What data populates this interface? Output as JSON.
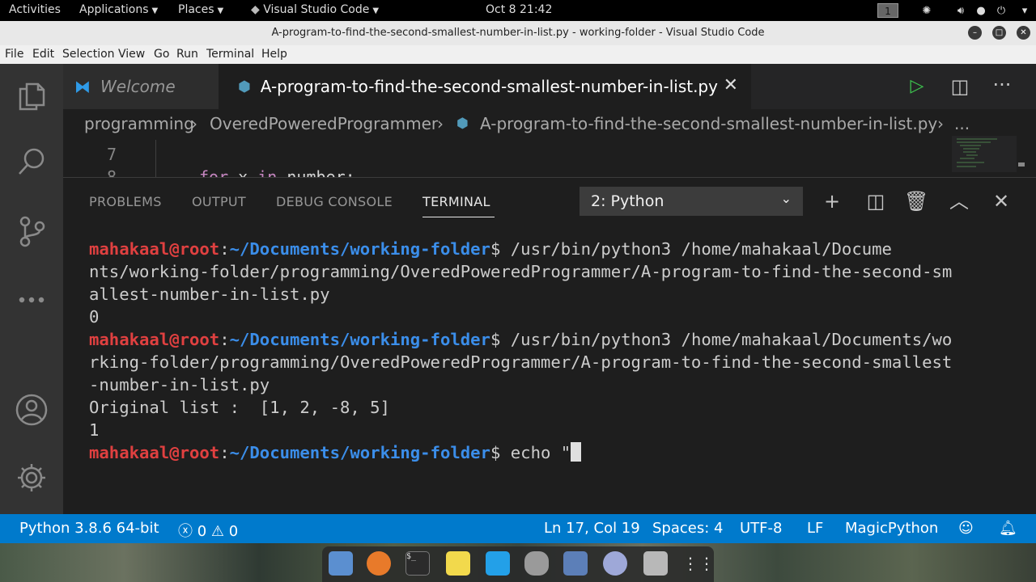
{
  "topbar": {
    "activities": "Activities",
    "applications": "Applications",
    "places": "Places",
    "app_name": "Visual Studio Code",
    "datetime": "Oct 8  21:42",
    "workspace": "1"
  },
  "window": {
    "title": "A-program-to-find-the-second-smallest-number-in-list.py - working-folder - Visual Studio Code"
  },
  "menu": [
    "File",
    "Edit",
    "Selection",
    "View",
    "Go",
    "Run",
    "Terminal",
    "Help"
  ],
  "tabs": {
    "welcome": "Welcome",
    "active": "A-program-to-find-the-second-smallest-number-in-list.py"
  },
  "breadcrumb": {
    "part1": "programming",
    "part2": "OveredPoweredProgrammer",
    "part3": "A-program-to-find-the-second-smallest-number-in-list.py",
    "more": "..."
  },
  "code": {
    "line7": "7",
    "line8": "8",
    "snippet_kw1": "for",
    "snippet_var": " x ",
    "snippet_kw2": "in",
    "snippet_rest": " number:"
  },
  "panel": {
    "tabs": [
      "PROBLEMS",
      "OUTPUT",
      "DEBUG CONSOLE",
      "TERMINAL"
    ],
    "terminal_select": "2: Python"
  },
  "terminal": {
    "user": "mahakaal@root",
    "sep": ":",
    "path": "~/Documents/working-folder",
    "dollar": "$ ",
    "run1_l1": "/usr/bin/python3 /home/mahakaal/Docume",
    "run1_l2": "nts/working-folder/programming/OveredPoweredProgrammer/A-program-to-find-the-second-sm",
    "run1_l3": "allest-number-in-list.py",
    "out1": "0",
    "run2_l1": "/usr/bin/python3 /home/mahakaal/Documents/wo",
    "run2_l2": "rking-folder/programming/OveredPoweredProgrammer/A-program-to-find-the-second-smallest",
    "run2_l3": "-number-in-list.py",
    "out2_l1": "Original list :  [1, 2, -8, 5]",
    "out2_l2": "1",
    "cmd3": "echo \""
  },
  "statusbar": {
    "python": "Python 3.8.6 64-bit",
    "errors": "0",
    "warnings": "0",
    "position": "Ln 17, Col 19",
    "spaces": "Spaces: 4",
    "encoding": "UTF-8",
    "eol": "LF",
    "language": "MagicPython"
  },
  "colors": {
    "statusbar": "#007acc",
    "user_prompt": "#e04040",
    "path_prompt": "#3b8eea"
  }
}
